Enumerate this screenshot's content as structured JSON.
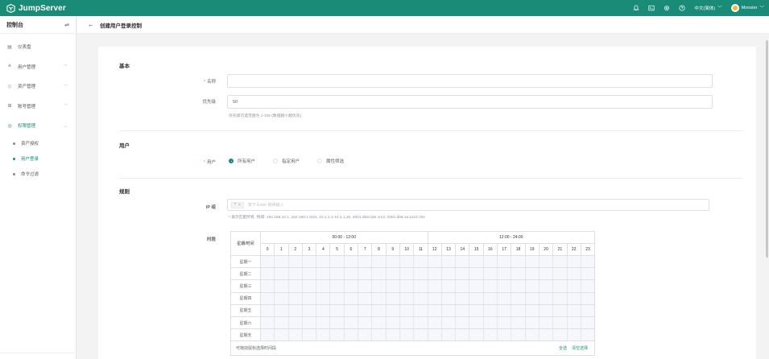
{
  "brand": "JumpServer",
  "topbar": {
    "language": "中文(简体)",
    "username": "Monster",
    "icons": [
      "bell-icon",
      "terminal-icon",
      "settings-icon",
      "help-icon"
    ]
  },
  "sidebar": {
    "title": "控制台",
    "items": [
      {
        "label": "仪表盘",
        "icon": "dashboard-icon"
      },
      {
        "label": "用户管理",
        "icon": "users-icon"
      },
      {
        "label": "资产管理",
        "icon": "assets-icon"
      },
      {
        "label": "账号管理",
        "icon": "accounts-icon"
      },
      {
        "label": "权限管理",
        "icon": "permissions-icon"
      }
    ],
    "subitems": [
      {
        "label": "资产授权"
      },
      {
        "label": "用户登录"
      },
      {
        "label": "命令过滤"
      }
    ]
  },
  "page": {
    "title": "创建用户登录控制"
  },
  "form": {
    "basic": {
      "section": "基本",
      "name_label": "名称",
      "name_value": "",
      "priority_label": "优先级",
      "priority_value": "50",
      "priority_hint": "优先级可选范围为 1-100 (数值越小越优先)"
    },
    "users": {
      "section": "用户",
      "label": "用户",
      "options": [
        "所有用户",
        "指定用户",
        "属性筛选"
      ],
      "selected": "所有用户"
    },
    "rules": {
      "section": "规则",
      "ip_label": "IP 组",
      "ip_tag": "*",
      "ip_placeholder": "按下 Enter 继续输入",
      "ip_hint": "* 表示匹配所有. 例如: 192.168.10.1, 192.168.1.0/24, 10.1.1.1-10.1.1.20, 2001:db8:2de::e13, 2001:db8:1a:1110::/64",
      "time_label": "时段",
      "grid": {
        "corner": "星期/时间",
        "half1": "00:00 - 12:00",
        "half2": "12:00 - 24:00",
        "hours": [
          "0",
          "1",
          "2",
          "3",
          "4",
          "5",
          "6",
          "7",
          "8",
          "9",
          "10",
          "11",
          "12",
          "13",
          "14",
          "15",
          "16",
          "17",
          "18",
          "19",
          "20",
          "21",
          "22",
          "23"
        ],
        "days": [
          "星期一",
          "星期二",
          "星期三",
          "星期四",
          "星期五",
          "星期六",
          "星期天"
        ],
        "footer_hint": "可拖动鼠标选择时间段",
        "select_all": "全选",
        "clear": "清空选择"
      }
    }
  },
  "colors": {
    "accent": "#1a8b77",
    "required": "#f56c6c"
  }
}
